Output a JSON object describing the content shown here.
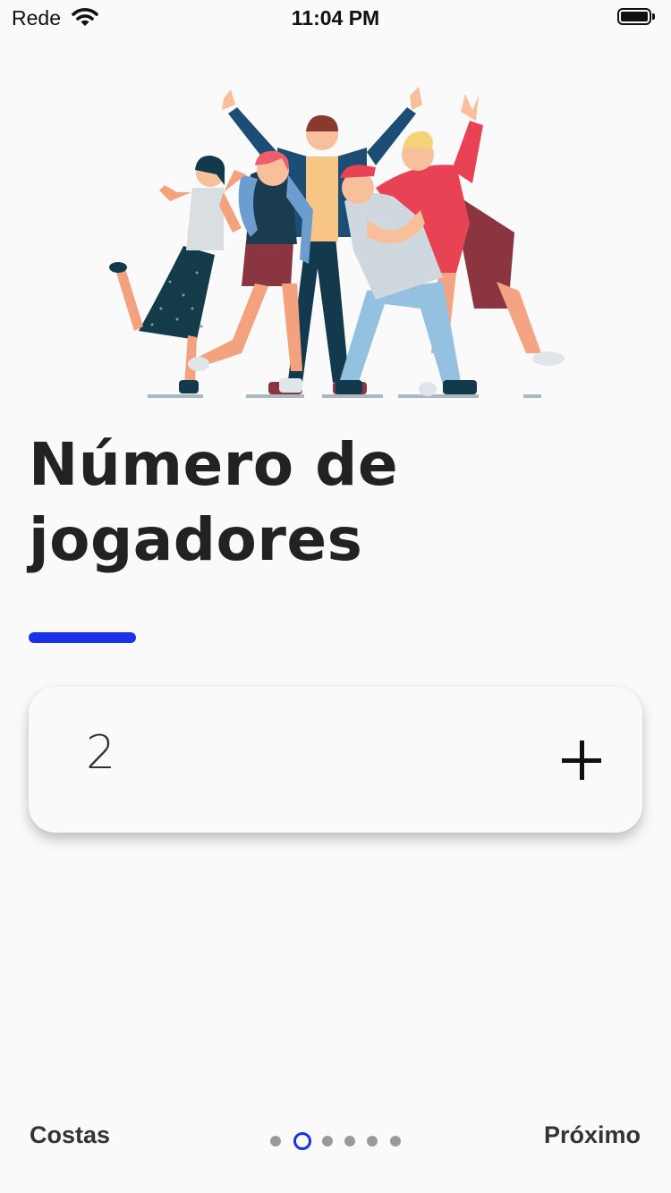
{
  "status_bar": {
    "carrier": "Rede",
    "time": "11:04 PM",
    "icons": [
      "wifi-icon",
      "battery-icon"
    ]
  },
  "illustration": {
    "name": "group-of-friends-illustration"
  },
  "screen": {
    "title": "Número de jogadores",
    "accent_color": "#1a31e8"
  },
  "stepper": {
    "value": "2",
    "increment_icon": "plus-icon"
  },
  "footer": {
    "back_label": "Costas",
    "next_label": "Próximo",
    "page_count": 6,
    "current_page": 2
  }
}
